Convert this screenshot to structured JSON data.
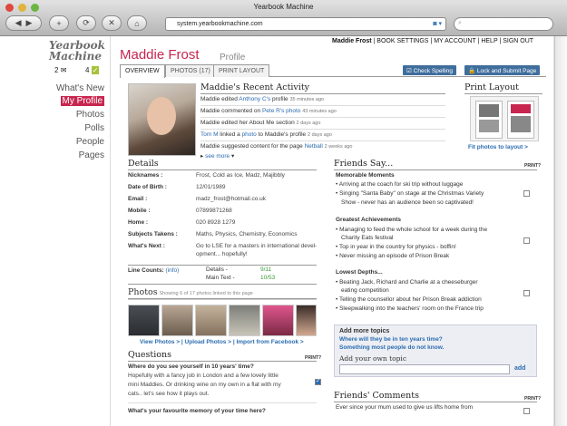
{
  "window": {
    "title": "Yearbook Machine",
    "url": "system.yearbookmachine.com",
    "search_placeholder": "Search"
  },
  "sidebar": {
    "logo": "Yearbook Machine",
    "messages_count": "2",
    "checks_count": "4",
    "items": [
      {
        "label": "What's New"
      },
      {
        "label": "My Profile",
        "selected": true
      },
      {
        "label": "Photos"
      },
      {
        "label": "Polls"
      },
      {
        "label": "People"
      },
      {
        "label": "Pages"
      }
    ]
  },
  "header": {
    "user": "Maddie Frost",
    "links": [
      "BOOK SETTINGS",
      "MY ACCOUNT",
      "HELP",
      "SIGN OUT"
    ],
    "name": "Maddie Frost",
    "subtitle": "Profile"
  },
  "tabs": [
    "OVERVIEW",
    "PHOTOS (17)",
    "PRINT LAYOUT"
  ],
  "buttons": {
    "check_spelling": "Check Spelling",
    "lock_submit": "Lock and Submit Page"
  },
  "activity": {
    "title": "Maddie's Recent Activity",
    "see_more": "see more",
    "items": [
      {
        "pre": "Maddie edited ",
        "link": "Anthony C's",
        "mid": " profile ",
        "link2": "",
        "post": "",
        "time": "35 minutes ago"
      },
      {
        "pre": "Maddie commented on ",
        "link": "Pete R's",
        "mid": " ",
        "link2": "photo",
        "post": "",
        "time": "43 minutes ago"
      },
      {
        "pre": "Maddie edited her About Me section ",
        "link": "",
        "mid": "",
        "link2": "",
        "post": "",
        "time": "2 days ago"
      },
      {
        "pre": "",
        "link": "Tom M",
        "mid": " linked a ",
        "link2": "photo",
        "post": " to Maddie's profile",
        "time": "2 days ago"
      },
      {
        "pre": "Maddie suggested content for the page ",
        "link": "Netball",
        "mid": "",
        "link2": "",
        "post": "",
        "time": "2 weeks ago"
      }
    ]
  },
  "print_layout": {
    "title": "Print Layout",
    "link": "Fit photos to layout >"
  },
  "details": {
    "title": "Details",
    "print": "PRINT?",
    "rows": [
      {
        "label": "Nicknames :",
        "value": "Frost, Cold as Ice, Madz, Majibbly"
      },
      {
        "label": "Date of Birth :",
        "value": "12/01/1989"
      },
      {
        "label": "Email :",
        "value": "madz_frost@hotmail.co.uk"
      },
      {
        "label": "Mobile :",
        "value": "07899871268"
      },
      {
        "label": "Home :",
        "value": "020 8928 1279"
      },
      {
        "label": "Subjects Takens :",
        "value": "Maths, Physics, Chemistry, Economics"
      },
      {
        "label": "What's Next :",
        "value": "Go to LSE for a masters in international devel-"
      },
      {
        "label": "",
        "value": "opment... hopefully!"
      }
    ],
    "line_counts": {
      "label": "Line Counts:",
      "info": "(info)",
      "details": "Details -",
      "details_val": "9/11",
      "main": "Main Text -",
      "main_val": "10/53"
    }
  },
  "photos": {
    "title": "Photos",
    "caption": "Showing 6 of 17 photos linked to this page",
    "links": "View Photos > | Upload Photos > | Import from Facebook >"
  },
  "questions": {
    "title": "Questions",
    "print": "PRINT?",
    "q1": "Where do you see yourself in 10 years' time?",
    "a1_1": "Hopefully with a fancy job in London and a few lovely little",
    "a1_2": "mini Maddies. Or drinking wine on my own in a flat with my",
    "a1_3": "cats.. let's see how it plays out.",
    "q2": "What's your favourite memory of your time here?"
  },
  "friends_say": {
    "title": "Friends Say...",
    "print": "PRINT?",
    "groups": [
      {
        "title": "Memorable Moments",
        "items": [
          "Arriving at the coach for ski trip without luggage",
          "Singing \"Santa Baby\" on stage at the Christmas Variety",
          "Show - never has an audience been so captivated!"
        ]
      },
      {
        "title": "Greatest Achievements",
        "items": [
          "Managing to feed the whole school for a week during the",
          "Charity Eats festival",
          "Top in year in the country for physics - boffin!",
          "Never missing an episode of Prison Break"
        ]
      },
      {
        "title": "Lowest Depths...",
        "items": [
          "Beating Jack, Richard and Charlie at a cheeseburger",
          "eating competition",
          "Telling the counsellor about her Prison Break addiction",
          "Sleepwalking into the teachers' room on the France trip"
        ]
      }
    ]
  },
  "add_topics": {
    "title": "Add more topics",
    "t1": "Where will they be in ten years time?",
    "t2": "Something most people do not know.",
    "own": "Add your own topic",
    "add": "add"
  },
  "friends_comments": {
    "title": "Friends' Comments",
    "print": "PRINT?",
    "text": "Ever since your mum used to give us lifts home from"
  }
}
